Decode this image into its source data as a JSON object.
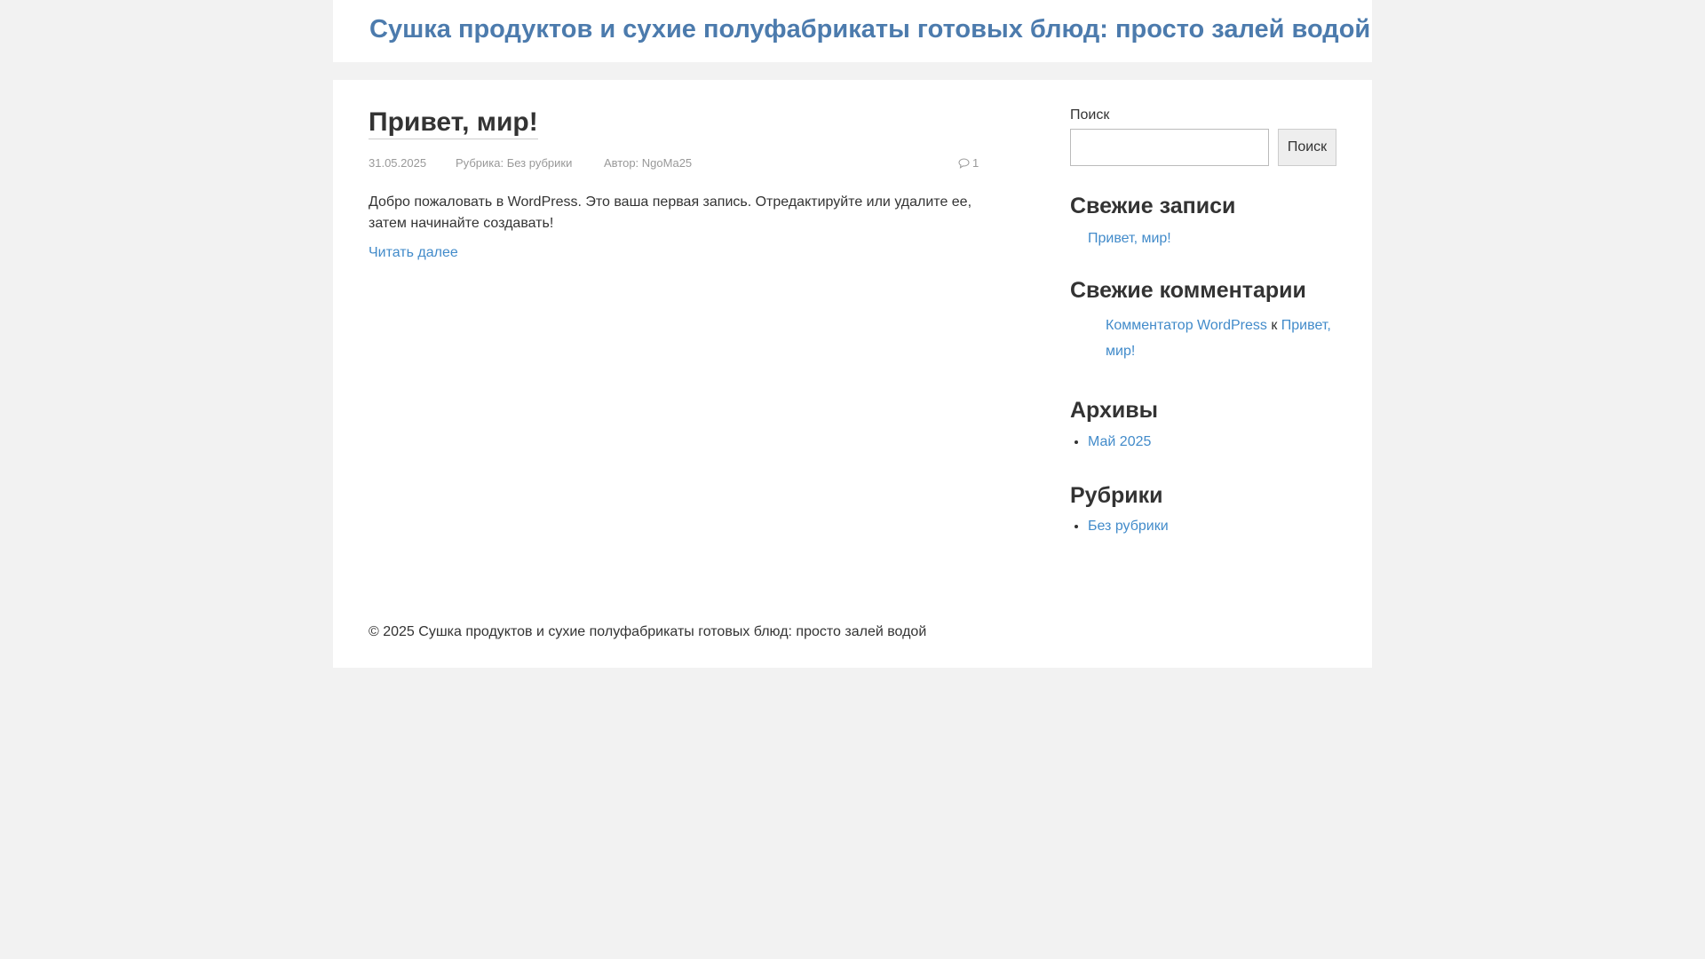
{
  "header": {
    "site_title": "Сушка продуктов и сухие полуфабрикаты готовых блюд: просто залей водой"
  },
  "post": {
    "title": "Привет, мир!",
    "date": "31.05.2025",
    "category_label": "Рубрика:",
    "category": "Без рубрики",
    "author_label": "Автор:",
    "author": "NgoMa25",
    "comment_count": "1",
    "comment_icon": "comment-icon",
    "excerpt": "Добро пожаловать в WordPress. Это ваша первая запись. Отредактируйте или удалите ее, затем начинайте создавать!",
    "read_more": "Читать далее"
  },
  "sidebar": {
    "search": {
      "label": "Поиск",
      "value": "",
      "button": "Поиск"
    },
    "recent_posts": {
      "title": "Свежие записи",
      "items": [
        "Привет, мир!"
      ]
    },
    "recent_comments": {
      "title": "Свежие комментарии",
      "author": "Комментатор WordPress",
      "connector": "к",
      "post": "Привет, мир!"
    },
    "archives": {
      "title": "Архивы",
      "items": [
        "Май 2025"
      ]
    },
    "categories": {
      "title": "Рубрики",
      "items": [
        "Без рубрики"
      ]
    }
  },
  "footer": {
    "copyright": "© 2025 Сушка продуктов и сухие полуфабрикаты готовых блюд: просто залей водой"
  },
  "colors": {
    "link": "#428bca",
    "site_title": "#4c7bad",
    "background": "#f2f2f2",
    "text": "#333333",
    "meta": "#999999"
  }
}
